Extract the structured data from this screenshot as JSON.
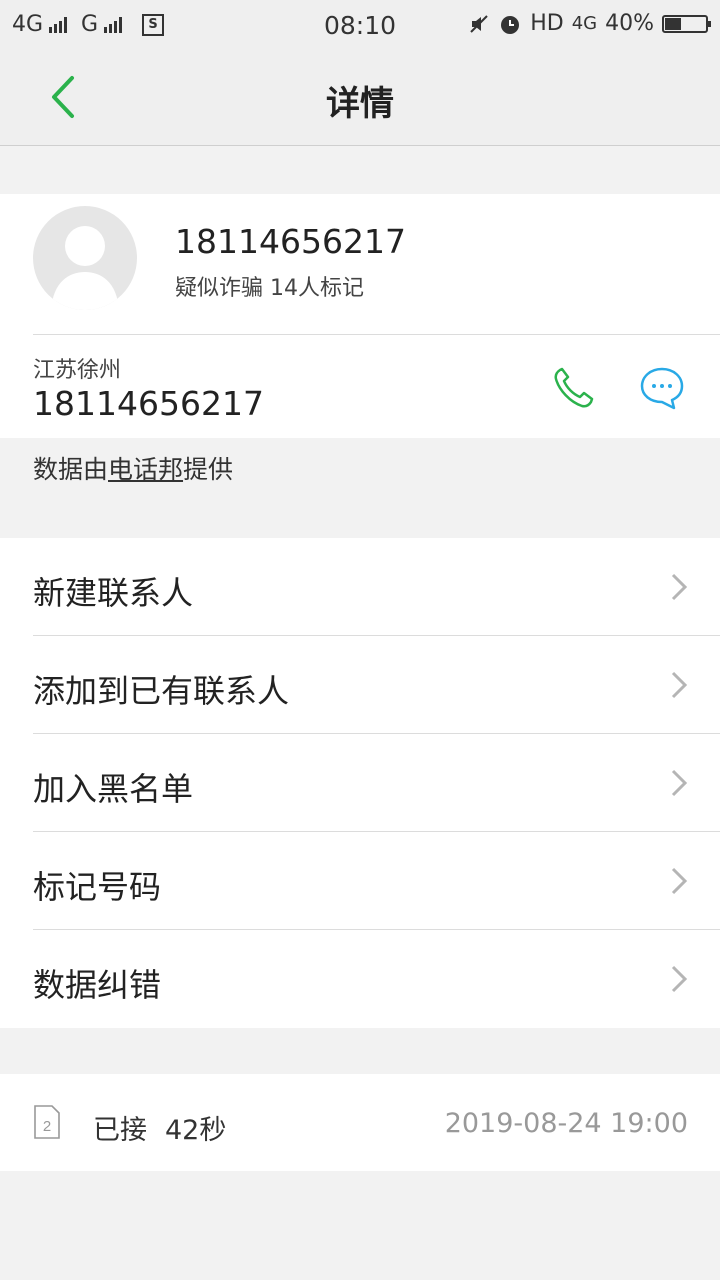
{
  "status_bar": {
    "net1": "4G",
    "net2": "G",
    "time": "08:10",
    "hd": "HD",
    "net3": "4G",
    "battery": "40%",
    "battery_level": 0.4
  },
  "header": {
    "title": "详情"
  },
  "caller": {
    "number": "18114656217",
    "tag": "疑似诈骗 14人标记",
    "location": "江苏徐州",
    "number_detail": "18114656217"
  },
  "provider": {
    "prefix": "数据由",
    "link": "电话邦",
    "suffix": "提供"
  },
  "menu": {
    "items": [
      {
        "label": "新建联系人"
      },
      {
        "label": "添加到已有联系人"
      },
      {
        "label": "加入黑名单"
      },
      {
        "label": "标记号码"
      },
      {
        "label": "数据纠错"
      }
    ]
  },
  "call_log": {
    "sim": "2",
    "status": "已接",
    "duration": "42秒",
    "datetime": "2019-08-24  19:00"
  },
  "colors": {
    "accent_green": "#2bb24c",
    "message_blue": "#29a9e6"
  },
  "icons": [
    "back-arrow-icon",
    "avatar-placeholder-icon",
    "phone-icon",
    "message-icon",
    "chevron-right-icon",
    "sim-card-icon",
    "alarm-icon",
    "mute-icon",
    "sim-status-icon"
  ]
}
